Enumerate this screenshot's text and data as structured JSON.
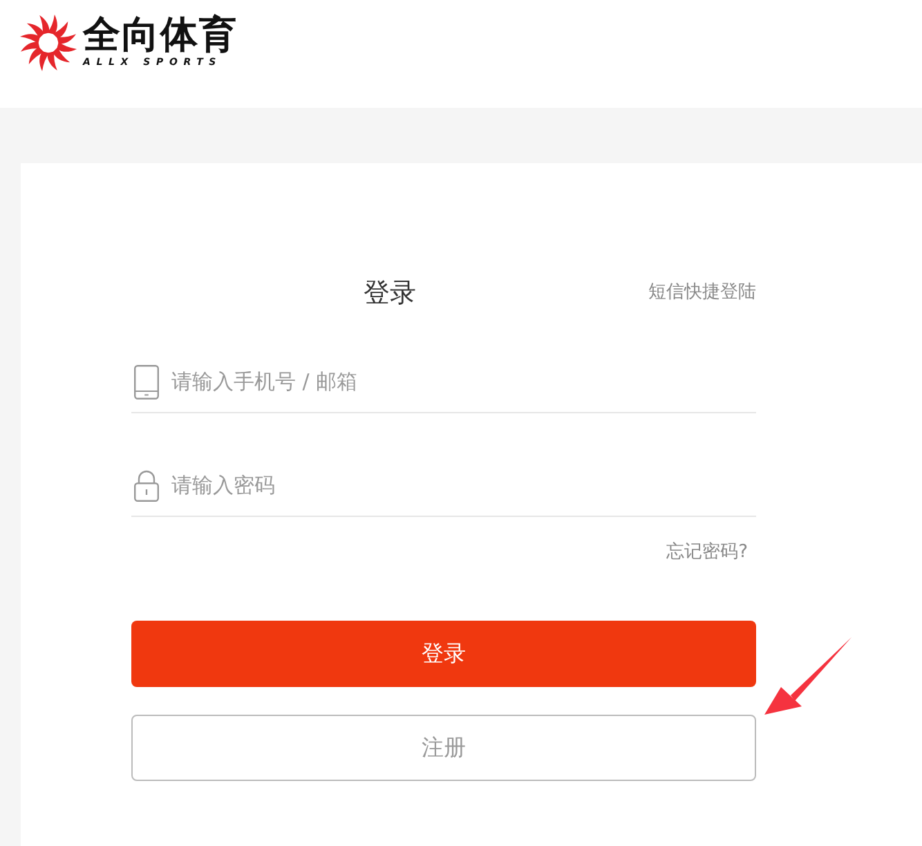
{
  "header": {
    "logo": {
      "name": "全向体育",
      "tagline": "ALLX SPORTS"
    }
  },
  "login_form": {
    "title": "登录",
    "sms_login_link": "短信快捷登陆",
    "fields": [
      {
        "kind": "phone",
        "placeholder": "请输入手机号 / 邮箱"
      },
      {
        "kind": "password",
        "placeholder": "请输入密码"
      }
    ],
    "forgot_password_link": "忘记密码?",
    "buttons": [
      {
        "kind": "primary",
        "label": "登录"
      },
      {
        "kind": "secondary",
        "label": "注册"
      }
    ]
  }
}
